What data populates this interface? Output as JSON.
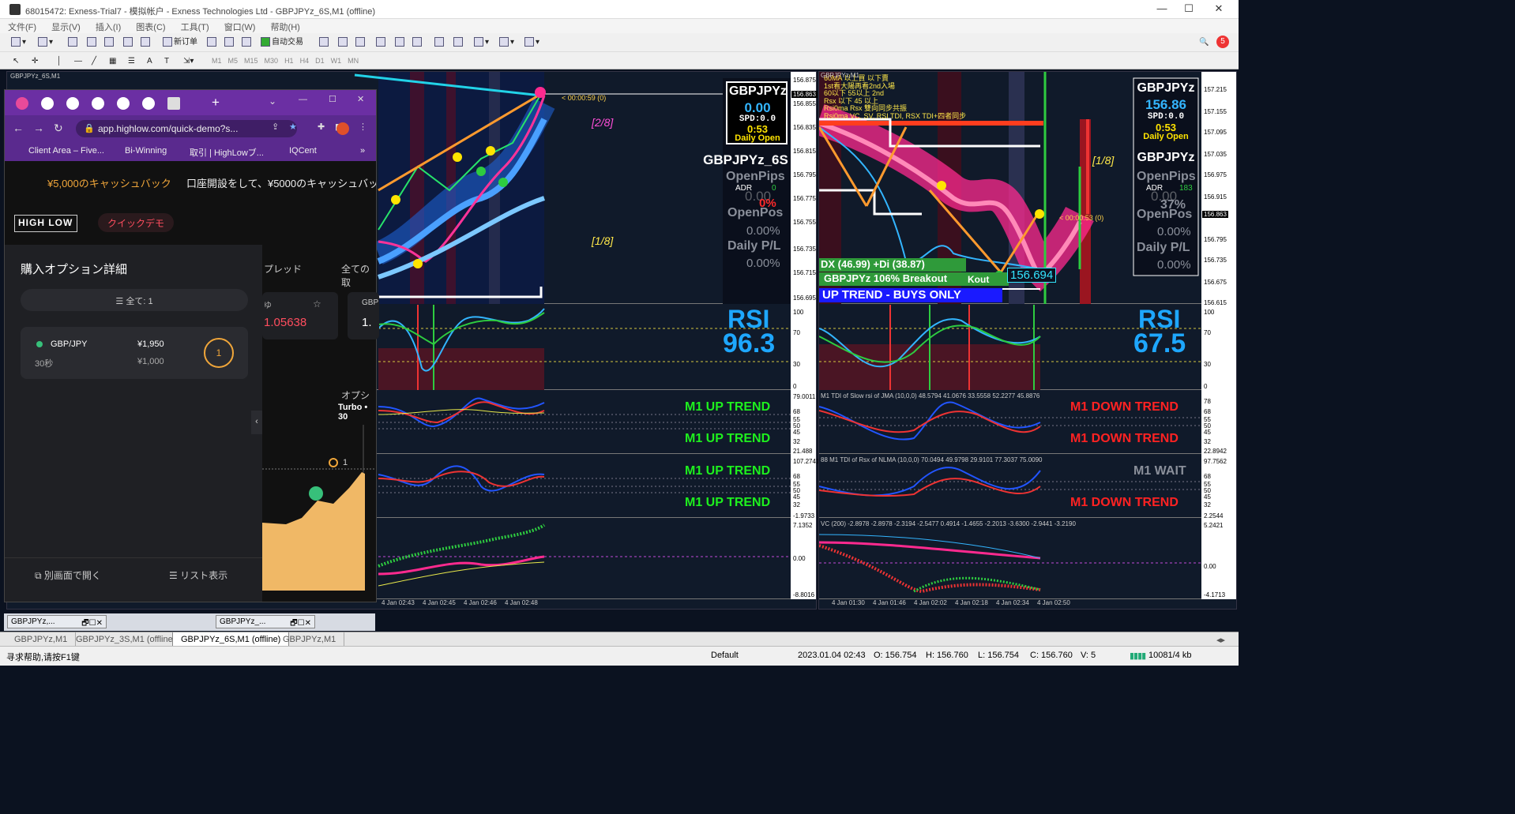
{
  "window": {
    "title": "68015472: Exness-Trial7 - 模拟帐户 - Exness Technologies Ltd - GBPJPYz_6S,M1 (offline)",
    "minimize": "—",
    "maximize": "☐",
    "close": "✕"
  },
  "menu": [
    "文件(F)",
    "显示(V)",
    "插入(I)",
    "图表(C)",
    "工具(T)",
    "窗口(W)",
    "帮助(H)"
  ],
  "toolbar": {
    "new_order": "新订单",
    "auto_trade": "自动交易",
    "timeframes": [
      "M1",
      "M5",
      "M15",
      "M30",
      "H1",
      "H4",
      "D1",
      "W1",
      "MN"
    ],
    "notify_count": "5"
  },
  "chart_left": {
    "header": "GBPJPYz_6S,M1",
    "timer": "< 00:00:59 (0)",
    "fib_top": "[2/8]",
    "fib_mid": "[1/8]",
    "price_axis": [
      "156.875",
      "156.863",
      "156.855",
      "156.835",
      "156.815",
      "156.795",
      "156.775",
      "156.755",
      "156.735",
      "156.715",
      "156.695"
    ],
    "info_box": {
      "symbol": "GBPJPYz",
      "pips": "0.00",
      "spd": "SPD:0.0",
      "time": "0:53",
      "daily": "Daily Open"
    },
    "panel": {
      "title": "GBPJPYz_6S",
      "openpips": "OpenPips",
      "adr": "ADR",
      "adr_val": "0",
      "dim1": "0.00",
      "pct": "0%",
      "openpos": "OpenPos",
      "openpos_val": "0.00%",
      "dailypl": "Daily P/L",
      "dailypl_val": "0.00%"
    },
    "rsi_label": "RSI",
    "rsi_value": "96.3",
    "rsi_axis": [
      "100",
      "70",
      "30",
      "0"
    ],
    "tdi1": {
      "line1": "M1 UP TREND",
      "line2": "M1 UP TREND",
      "axis": [
        "79.0011",
        "68",
        "55",
        "50",
        "45",
        "32",
        "21.488"
      ]
    },
    "tdi2": {
      "line1": "M1 UP TREND",
      "line2": "M1 UP TREND",
      "axis": [
        "107.2741",
        "68",
        "55",
        "50",
        "45",
        "32",
        "-1.9733"
      ]
    },
    "osc_axis": [
      "7.1352",
      "0.00",
      "-8.8016"
    ],
    "time_axis": [
      "4 Jan 02:43",
      "4 Jan 02:45",
      "4 Jan 02:46",
      "4 Jan 02:48"
    ]
  },
  "chart_right": {
    "header": "GBPJPYz,M1",
    "notes": [
      "60MA 以上買 以下賣",
      "1st看大陽再看2nd入場",
      "60以下 55以上 2nd",
      "Rsx 以下 45 以上",
      "Rsi0ma Rsx 雙向同步共振",
      "Rsi0ma VC, SV, RSI TDI, RSX TDI+四者同步"
    ],
    "timer": "< 00:00:53 (0)",
    "fib": "[1/8]",
    "price_axis": [
      "157.215",
      "157.155",
      "157.095",
      "157.035",
      "156.975",
      "156.915",
      "156.863",
      "156.795",
      "156.735",
      "156.675",
      "156.615"
    ],
    "info_box": {
      "symbol": "GBPJPYz",
      "price": "156.86",
      "spd": "SPD:0.0",
      "time": "0:53",
      "daily": "Daily Open"
    },
    "panel": {
      "title": "GBPJPYz",
      "openpips": "OpenPips",
      "adr": "ADR",
      "adr_val": "183",
      "dim1": "0.00",
      "pct": "37%",
      "openpos": "OpenPos",
      "openpos_val": "0.00%",
      "dailypl": "Daily P/L",
      "dailypl_val": "0.00%"
    },
    "dx": "DX (46.99)  +Di (38.87)",
    "breakout": "GBPJPYz 106% Breakout",
    "breakout_tag": "Kout",
    "last_price": "156.694",
    "trend_banner": "UP TREND - BUYS ONLY",
    "rsi_label": "RSI",
    "rsi_value": "67.5",
    "rsi_axis": [
      "100",
      "70",
      "30",
      "0"
    ],
    "tdi1": {
      "header": "M1 TDI of Slow rsi of JMA (10,0,0) 48.5794 41.0676 33.5558 52.2277 45.8876",
      "line1": "M1 DOWN TREND",
      "line2": "M1 DOWN TREND",
      "axis": [
        "78",
        "68",
        "55",
        "50",
        "45",
        "32",
        "22.8942"
      ]
    },
    "tdi2": {
      "header": "88 M1 TDI of Rsx of NLMA (10,0,0) 70.0494 49.9798 29.9101 77.3037 75.0090",
      "line1": "M1 WAIT",
      "line2": "M1 DOWN TREND",
      "axis": [
        "97.7562",
        "68",
        "55",
        "50",
        "45",
        "32",
        "2.2544"
      ]
    },
    "osc": {
      "header": "VC (200) -2.8978 -2.8978 -2.3194 -2.5477 0.4914 -1.4655 -2.2013 -3.6300 -2.9441 -3.2190",
      "axis": [
        "5.2421",
        "0.00",
        "-4.1713"
      ]
    },
    "time_axis": [
      "4 Jan 01:30",
      "4 Jan 01:46",
      "4 Jan 02:02",
      "4 Jan 02:18",
      "4 Jan 02:34",
      "4 Jan 02:50"
    ]
  },
  "browser": {
    "tab_new": "+",
    "url": "app.highlow.com/quick-demo?s...",
    "bookmarks": [
      "Client Area – Five...",
      "Bi-Winning",
      "取引 | HighLowブ...",
      "IQCent"
    ],
    "bookmarks_more": "»",
    "banner_left": "¥5,000のキャッシュバック",
    "banner_right": "口座開設をして、¥5000のキャッシュバッ",
    "logo": "HIGH LOW",
    "quick_demo": "クイックデモ",
    "panel_title": "購入オプション詳細",
    "filter": "全て: 1",
    "option": {
      "pair": "GBP/JPY",
      "duration": "30秒",
      "payout": "¥1,950",
      "stake": "¥1,000",
      "count": "1"
    },
    "spread_label": "プレッド",
    "all_label": "全ての取",
    "price_red": "1.05638",
    "price_white": "1.",
    "pair_short": "GBP",
    "option_side": "オプシ",
    "turbo": "Turbo • 30",
    "chart_marker": "1",
    "open_new": "別画面で開く",
    "list_view": "リスト表示"
  },
  "mdi_tabs": [
    "GBPJPYz,...",
    "GBPJPYz_..."
  ],
  "chart_tabs": [
    "GBPJPYz,M1",
    "GBPJPYz_3S,M1 (offline)",
    "GBPJPYz_6S,M1 (offline)",
    "GBPJPYz,M1"
  ],
  "status": {
    "help": "寻求帮助,请按F1键",
    "profile": "Default",
    "datetime": "2023.01.04 02:43",
    "open": "O: 156.754",
    "high": "H: 156.760",
    "low": "L: 156.754",
    "close": "C: 156.760",
    "volume": "V: 5",
    "traffic": "10081/4 kb"
  }
}
